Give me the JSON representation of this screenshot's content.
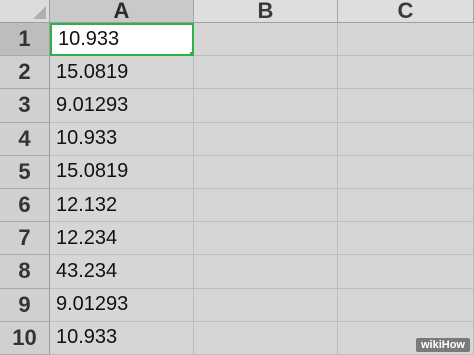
{
  "sheet": {
    "columns": [
      "A",
      "B",
      "C"
    ],
    "rows": [
      {
        "num": "1",
        "a": "10.933"
      },
      {
        "num": "2",
        "a": "15.0819"
      },
      {
        "num": "3",
        "a": "9.01293"
      },
      {
        "num": "4",
        "a": "10.933"
      },
      {
        "num": "5",
        "a": "15.0819"
      },
      {
        "num": "6",
        "a": "12.132"
      },
      {
        "num": "7",
        "a": "12.234"
      },
      {
        "num": "8",
        "a": "43.234"
      },
      {
        "num": "9",
        "a": "9.01293"
      },
      {
        "num": "10",
        "a": "10.933"
      }
    ],
    "active_cell": "A1",
    "selection_color": "#2bb24c"
  },
  "watermark": "wikiHow"
}
